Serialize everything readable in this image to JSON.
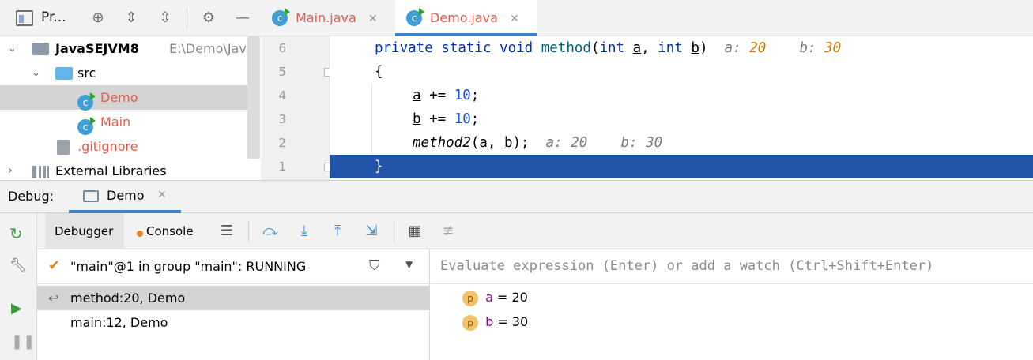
{
  "project_panel": {
    "title": "Pr...",
    "tree": {
      "project_name": "JavaSEJVM8",
      "project_path": "E:\\Demo\\Jav",
      "src": "src",
      "demo": "Demo",
      "main": "Main",
      "gitignore": ".gitignore",
      "external": "External Libraries"
    }
  },
  "editor": {
    "tabs": [
      "Main.java",
      "Demo.java"
    ],
    "lines": [
      {
        "num": "6"
      },
      {
        "num": "5"
      },
      {
        "num": "4"
      },
      {
        "num": "3"
      },
      {
        "num": "2"
      },
      {
        "num": "1"
      }
    ],
    "code": {
      "l1_kw": "private static void ",
      "l1_name": "method",
      "l1_p1": "(",
      "l1_int1": "int ",
      "l1_a": "a",
      "l1_comma": ", ",
      "l1_int2": "int ",
      "l1_b": "b",
      "l1_close": ")",
      "l1_hint_a": "a: ",
      "l1_hint_a_val": "20",
      "l1_hint_b": "b: ",
      "l1_hint_b_val": "30",
      "l2": "{",
      "l3_var": "a",
      "l3_op": " += ",
      "l3_num": "10",
      "l3_end": ";",
      "l4_var": "b",
      "l4_op": " += ",
      "l4_num": "10",
      "l4_end": ";",
      "l5_call": "method2",
      "l5_args_open": "(",
      "l5_a": "a",
      "l5_comma": ", ",
      "l5_b": "b",
      "l5_end": ");",
      "l5_hint": "a: 20    b: 30",
      "l6": "}"
    }
  },
  "debug": {
    "label": "Debug:",
    "session_tab": "Demo",
    "tabs": [
      "Debugger",
      "Console"
    ],
    "thread": "\"main\"@1 in group \"main\": RUNNING",
    "frames": [
      "method:20, Demo",
      "main:12, Demo"
    ],
    "evaluate_placeholder": "Evaluate expression (Enter) or add a watch (Ctrl+Shift+Enter)",
    "variables": [
      {
        "badge": "p",
        "name": "a",
        "eq": " = ",
        "value": "20"
      },
      {
        "badge": "p",
        "name": "b",
        "eq": " = ",
        "value": "30"
      }
    ]
  },
  "colors": {
    "accent": "#4083c9",
    "current_line": "#2154a8",
    "class_name": "#e35d4e"
  }
}
